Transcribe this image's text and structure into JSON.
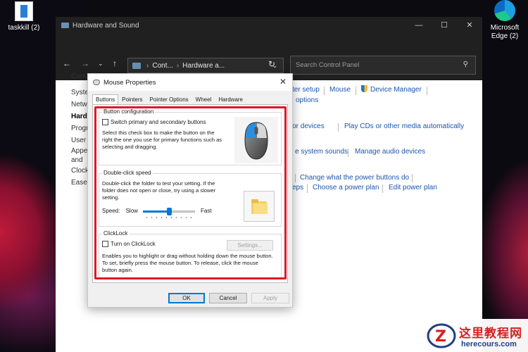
{
  "desktop": {
    "icons": [
      {
        "label": "taskkill (2)"
      },
      {
        "label": "Microsoft Edge (2)"
      }
    ]
  },
  "cp_window": {
    "title": "Hardware and Sound",
    "controls": [
      "—",
      "☐",
      "✕"
    ],
    "address_parts": [
      "Cont...",
      "Hardware a..."
    ],
    "search_placeholder": "Search Control Panel",
    "sidebar": [
      "Control Panel Home",
      "System and Security",
      "Network and Internet",
      "Hardware and Sound",
      "Programs",
      "User Accounts",
      "Appearance and Personalization",
      "Clock and Region",
      "Ease of Access"
    ],
    "links": {
      "printer_setup": "ter setup",
      "mouse": "Mouse",
      "device_manager": "Device Manager",
      "options": "options",
      "media_devices": "dia or devices",
      "play_cds": "Play CDs or other media automatically",
      "system_sounds": "e system sounds",
      "manage_audio": "Manage audio devices",
      "power_buttons": "Change what the power buttons do",
      "eps": "eps",
      "power_plan": "Choose a power plan",
      "edit_plan": "Edit power plan"
    }
  },
  "dialog": {
    "title": "Mouse Properties",
    "close": "✕",
    "tabs": [
      "Buttons",
      "Pointers",
      "Pointer Options",
      "Wheel",
      "Hardware"
    ],
    "button_config": {
      "label": "Button configuration",
      "checkbox": "Switch primary and secondary buttons",
      "checked": false,
      "description": "Select this check box to make the button on the right the one you use for primary functions such as selecting and dragging."
    },
    "double_click": {
      "label": "Double-click speed",
      "description": "Double-click the folder to test your setting. If the folder does not open or close, try using a slower setting.",
      "speed_label": "Speed:",
      "slow": "Slow",
      "fast": "Fast",
      "level": 0.5
    },
    "clicklock": {
      "label": "ClickLock",
      "checkbox": "Turn on ClickLock",
      "checked": false,
      "settings_button": "Settings...",
      "description": "Enables you to highlight or drag without holding down the mouse button. To set, briefly press the mouse button. To release, click the mouse button again."
    },
    "buttons": {
      "ok": "OK",
      "cancel": "Cancel",
      "apply": "Apply"
    }
  },
  "watermark": {
    "cn": "这里教程网",
    "en": "herecours.com"
  },
  "colors": {
    "highlight": "#e0162b",
    "link": "#1a56b0",
    "titlebar": "#202020"
  }
}
